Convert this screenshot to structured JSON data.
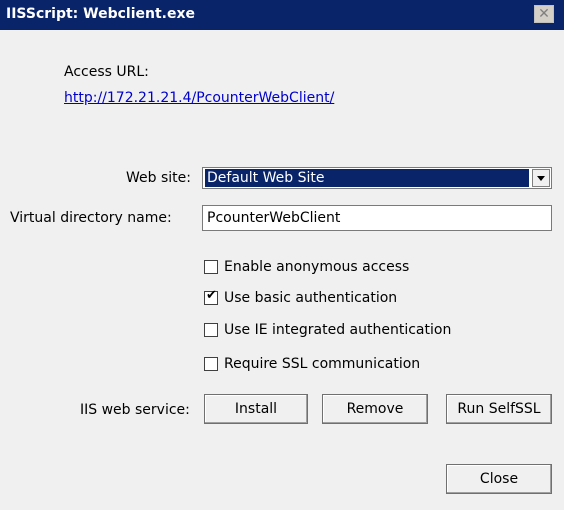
{
  "window": {
    "title": "IISScript: Webclient.exe",
    "close_glyph": "✕"
  },
  "access": {
    "label": "Access URL:",
    "url": "http://172.21.21.4/PcounterWebClient/"
  },
  "website": {
    "label": "Web site:",
    "selected": "Default Web Site"
  },
  "vdir": {
    "label": "Virtual directory name:",
    "value": "PcounterWebClient"
  },
  "options": [
    {
      "label": "Enable anonymous access",
      "checked": false
    },
    {
      "label": "Use basic authentication",
      "checked": true
    },
    {
      "label": "Use IE integrated authentication",
      "checked": false
    },
    {
      "label": "Require SSL communication",
      "checked": false
    }
  ],
  "service": {
    "label": "IIS web service:",
    "install": "Install",
    "remove": "Remove",
    "selfssl": "Run SelfSSL"
  },
  "footer": {
    "close": "Close"
  }
}
